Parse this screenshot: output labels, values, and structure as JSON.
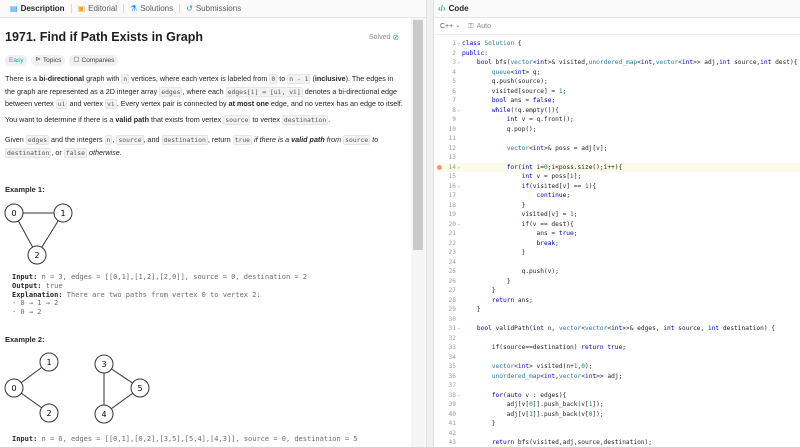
{
  "tabs": [
    {
      "label": "Description",
      "icon": "description-icon",
      "active": true
    },
    {
      "label": "Editorial",
      "icon": "editorial-icon",
      "active": false
    },
    {
      "label": "Solutions",
      "icon": "solutions-icon",
      "active": false
    },
    {
      "label": "Submissions",
      "icon": "submissions-icon",
      "active": false
    }
  ],
  "problem": {
    "title": "1971. Find if Path Exists in Graph",
    "solved": "Solved",
    "difficulty": "Easy",
    "topics": "Topics",
    "companies": "Companies",
    "p1": {
      "a": "There is a ",
      "b": "bi-directional",
      "c": " graph with ",
      "n": "n",
      "d": " vertices, where each vertex is labeled from ",
      "z": "0",
      "to": " to ",
      "nm1": "n - 1",
      "e": " (",
      "inclusive": "inclusive",
      "f": "). The edges in the graph are represented as a 2D integer array ",
      "edges": "edges",
      "g": ", where each ",
      "edgesi": "edges[i] = [ui, vi]",
      "h": " denotes a bi-directional edge between vertex ",
      "ui": "ui",
      "and": " and vertex ",
      "vi": "vi",
      "j": ". Every vertex pair is connected by ",
      "atmost": "at most one",
      "k": " edge, and no vertex has an edge to itself."
    },
    "p2": {
      "a": "You want to determine if there is a ",
      "b": "valid path",
      "c": " that exists from vertex ",
      "src": "source",
      "d": " to vertex ",
      "dst": "destination",
      "e": "."
    },
    "p3": {
      "a": "Given ",
      "edges": "edges",
      "b": " and the integers ",
      "n": "n",
      "c": ", ",
      "src": "source",
      "d": ", and ",
      "dst": "destination",
      "e": ", return ",
      "t": "true",
      "f": " if there is a ",
      "vp": "valid path",
      "g": " from ",
      "src2": "source",
      "h": " to ",
      "dst2": "destination",
      "i": ", or ",
      "fl": "false",
      "j": " otherwise."
    }
  },
  "examples": [
    {
      "title": "Example 1:",
      "nodes": [
        "0",
        "1",
        "2"
      ],
      "input_label": "Input:",
      "input": "n = 3, edges = [[0,1],[1,2],[2,0]], source = 0, destination = 2",
      "output_label": "Output:",
      "output": "true",
      "expl_label": "Explanation:",
      "expl": "There are two paths from vertex 0 to vertex 2:",
      "l1": "- 0 → 1 → 2",
      "l2": "- 0 → 2"
    },
    {
      "title": "Example 2:",
      "nodes": [
        "0",
        "1",
        "2",
        "3",
        "4",
        "5"
      ],
      "input_label": "Input:",
      "input": "n = 6, edges = [[0,1],[0,2],[3,5],[5,4],[4,3]], source = 0, destination = 5"
    }
  ],
  "editor": {
    "header": "Code",
    "language": "C++",
    "auto": "Auto",
    "lines": [
      "class Solution {",
      "public:",
      "    bool bfs(vector<int>& visited,unordered_map<int,vector<int>> adj,int source,int dest){",
      "        queue<int> q;",
      "        q.push(source);",
      "        visited[source] = 1;",
      "        bool ans = false;",
      "        while(!q.empty()){",
      "            int v = q.front();",
      "            q.pop();",
      "",
      "            vector<int>& poss = adj[v];",
      "",
      "            for(int i=0;i<poss.size();i++){",
      "                int v = poss[i];",
      "                if(visited[v] == 1){",
      "                    continue;",
      "                }",
      "                visited[v] = 1;",
      "                if(v == dest){",
      "                    ans = true;",
      "                    break;",
      "                }",
      "",
      "                q.push(v);",
      "            }",
      "        }",
      "        return ans;",
      "    }",
      "",
      "    bool validPath(int n, vector<vector<int>>& edges, int source, int destination) {",
      "",
      "        if(source==destination) return true;",
      "",
      "        vector<int> visited(n+1,0);",
      "        unordered_map<int,vector<int>> adj;",
      "",
      "        for(auto v : edges){",
      "            adj[v[0]].push_back(v[1]);",
      "            adj[v[1]].push_back(v[0]);",
      "        }",
      "",
      "        return bfs(visited,adj,source,destination);"
    ]
  },
  "colors": {
    "accent_green": "#2db55d",
    "easy": "#00b8a3",
    "keyword": "#0000c8"
  }
}
